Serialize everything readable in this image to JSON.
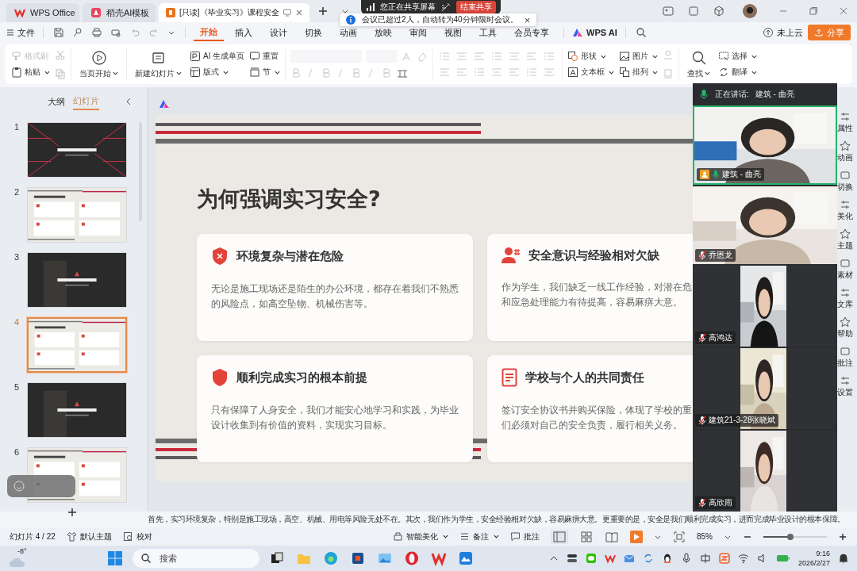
{
  "window_tabs": [
    {
      "label": "WPS Office",
      "selected": false
    },
    {
      "label": "稻壳AI模板",
      "selected": false
    },
    {
      "label": "[只读]《毕业实习》课程安全",
      "selected": true
    }
  ],
  "screen_share": {
    "status": "您正在共享屏幕",
    "stop_button": "结束共享"
  },
  "toast": {
    "message": "会议已超过2人，自动转为40分钟限时会议。",
    "close": "×"
  },
  "menu": {
    "file": "文件",
    "tabs": [
      {
        "label": "开始",
        "selected": true
      },
      {
        "label": "插入",
        "selected": false
      },
      {
        "label": "设计",
        "selected": false
      },
      {
        "label": "切换",
        "selected": false
      },
      {
        "label": "动画",
        "selected": false
      },
      {
        "label": "放映",
        "selected": false
      },
      {
        "label": "审阅",
        "selected": false
      },
      {
        "label": "视图",
        "selected": false
      },
      {
        "label": "工具",
        "selected": false
      },
      {
        "label": "会员专享",
        "selected": false
      }
    ],
    "ai": "WPS AI",
    "cloud": "未上云",
    "share": "分享"
  },
  "ribbon": {
    "format_painter": {
      "label": "格式刷",
      "disabled": true
    },
    "paste": "粘贴",
    "play_from_current": "当页开始",
    "new_slide": "新建幻灯片",
    "ai_page": "AI 生成单页",
    "layout": "版式",
    "reset": "重置",
    "section": "节",
    "shape": "形状",
    "textbox": "文本框",
    "picture": "图片",
    "arrange": "排列",
    "find": "查找",
    "select": "选择",
    "translate": "翻译"
  },
  "panel": {
    "tabs": [
      {
        "label": "大纲",
        "selected": false
      },
      {
        "label": "幻灯片",
        "selected": true
      }
    ],
    "slides": [
      {
        "number": "1",
        "kind": "dark",
        "selected": false
      },
      {
        "number": "2",
        "kind": "light",
        "selected": false
      },
      {
        "number": "3",
        "kind": "dark",
        "selected": false
      },
      {
        "number": "4",
        "kind": "light",
        "selected": true
      },
      {
        "number": "5",
        "kind": "dark",
        "selected": false
      },
      {
        "number": "6",
        "kind": "light",
        "selected": false
      }
    ]
  },
  "slide": {
    "title": "为何强调实习安全?",
    "cards": [
      {
        "title": "环境复杂与潜在危险",
        "lines": [
          "无论是施工现场还是陌生的办公环境，都存在着我们不熟悉",
          "的风险点，如高空坠物、机械伤害等。"
        ]
      },
      {
        "title": "安全意识与经验相对欠缺",
        "lines": [
          "作为学生，我们缺乏一线工作经验，对潜在危",
          "和应急处理能力有待提高，容易麻痹大意。"
        ]
      },
      {
        "title": "顺利完成实习的根本前提",
        "lines": [
          "只有保障了人身安全，我们才能安心地学习和实践，为毕业",
          "设计收集到有价值的资料，实现实习目标。"
        ]
      },
      {
        "title": "学校与个人的共同责任",
        "lines": [
          "签订安全协议书并购买保险，体现了学校的重",
          "们必须对自己的安全负责，履行相关义务。"
        ]
      }
    ]
  },
  "video": {
    "speaking_label": "正在讲话:",
    "speaker": "建筑 - 曲亮",
    "tiles": [
      {
        "name": "建筑 - 曲亮",
        "kind": "wide",
        "speaking": true,
        "muted": false
      },
      {
        "name": "乔恩龙",
        "kind": "wide",
        "speaking": false,
        "muted": true
      },
      {
        "name": "高鸿达",
        "kind": "narrow",
        "speaking": false,
        "muted": true
      },
      {
        "name": "建筑21-3-28张晓斌",
        "kind": "narrow",
        "speaking": false,
        "muted": true
      },
      {
        "name": "高欣雨",
        "kind": "narrow",
        "speaking": false,
        "muted": true
      }
    ]
  },
  "sidebar": [
    "属性",
    "动画",
    "切换",
    "美化",
    "主题",
    "素材",
    "文库",
    "帮助",
    "批注",
    "设置"
  ],
  "notes": "首先，实习环境复杂，特别是施工现场，高空、机械、用电等风险无处不在。其次，我们作为学生，安全经验相对欠缺，容易麻痹大意。更重要的是，安全是我们顺利完成实习，进而完成毕业设计的根本保障。",
  "status_bar": {
    "slide_count": "幻灯片 4 / 22",
    "theme": "默认主题",
    "proofread": "校对",
    "beautify": "智能美化",
    "notes": "备注",
    "comments": "批注",
    "zoom": "85%",
    "zoom_slider": {
      "level": 0.42
    }
  },
  "taskbar": {
    "weather": "-8°",
    "search": "搜索",
    "time": "9:16",
    "date": "2026/2/27"
  }
}
